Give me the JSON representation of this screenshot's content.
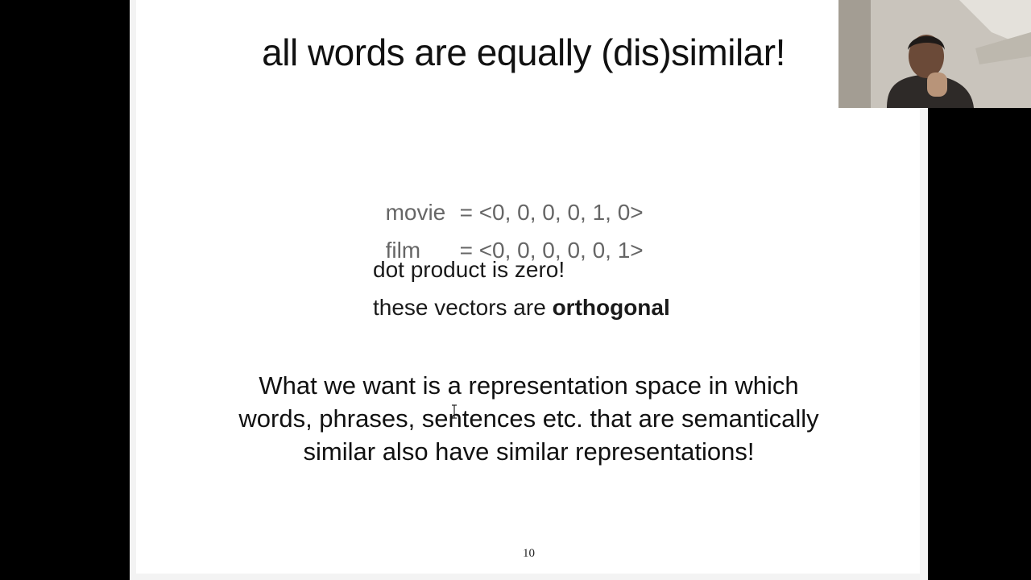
{
  "slide": {
    "title": "all words are equally (dis)similar!",
    "vectors": [
      {
        "word": "movie",
        "value": "= <0, 0, 0, 0, 1, 0>"
      },
      {
        "word": "film",
        "value": "= <0, 0, 0, 0, 0, 1>"
      }
    ],
    "dot_product_text": "dot product is zero!",
    "orthogonal_prefix": "these vectors are ",
    "orthogonal_bold": "orthogonal",
    "paragraph_lines": [
      "What we want is a representation space in which",
      "words, phrases, sentences etc. that are semantically",
      "similar also have similar representations!"
    ],
    "page_number": "10"
  },
  "webcam": {
    "icon": "person-video-feed"
  }
}
